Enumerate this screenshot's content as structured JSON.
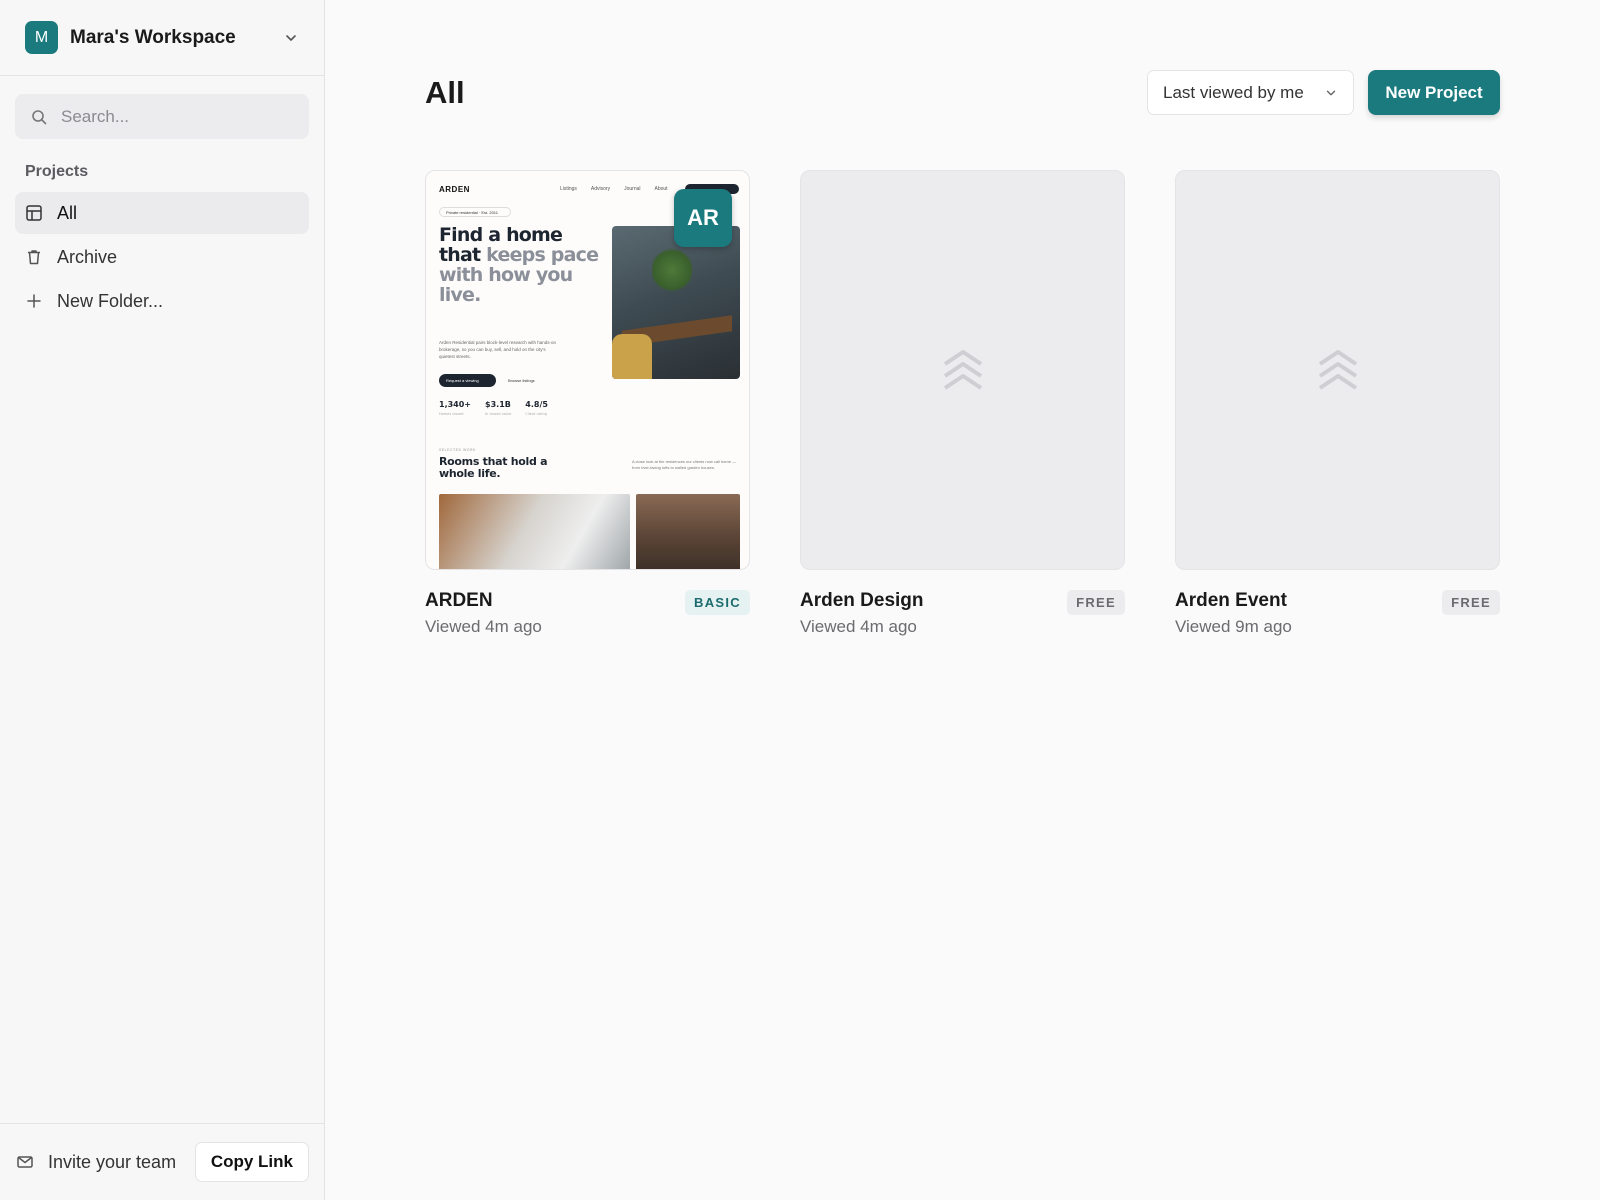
{
  "workspace": {
    "avatar": "M",
    "name": "Mara's Workspace"
  },
  "search": {
    "placeholder": "Search..."
  },
  "sidebar": {
    "section_label": "Projects",
    "items": [
      {
        "label": "All",
        "icon": "grid-icon",
        "active": true
      },
      {
        "label": "Archive",
        "icon": "trash-icon",
        "active": false
      },
      {
        "label": "New Folder...",
        "icon": "plus-icon",
        "active": false
      }
    ]
  },
  "footer": {
    "invite_label": "Invite your team",
    "copy_link_label": "Copy Link"
  },
  "header": {
    "title": "All",
    "sort_label": "Last viewed by me",
    "new_project_label": "New Project"
  },
  "colors": {
    "accent": "#1b7a7e"
  },
  "projects": [
    {
      "name": "ARDEN",
      "viewed": "Viewed 4m ago",
      "badge": "BASIC",
      "preview": {
        "logo": "ARDEN",
        "nav_links": [
          "Listings",
          "Advisory",
          "Journal",
          "About"
        ],
        "pill": "Private residential · Est. 2011",
        "headline_dark": "Find a home that",
        "headline_muted": "keeps pace with how you live.",
        "body": "Arden Residential pairs block-level research with hands-on brokerage, so you can buy, sell, and hold on the city's quietest streets.",
        "btn_primary": "Request a viewing",
        "btn_secondary": "Browse listings",
        "stats": [
          {
            "value": "1,340+",
            "label": "Homes closed"
          },
          {
            "value": "$3.1B",
            "label": "In closed value"
          },
          {
            "value": "4.8/5",
            "label": "Client rating"
          }
        ],
        "avatar": "AR",
        "eyebrow": "SELECTED WORK",
        "section_title": "Rooms that hold a whole life.",
        "section_side": "A close look at the residences our clients now call home — from river-facing lofts to walled garden houses."
      }
    },
    {
      "name": "Arden Design",
      "viewed": "Viewed 4m ago",
      "badge": "FREE"
    },
    {
      "name": "Arden Event",
      "viewed": "Viewed 9m ago",
      "badge": "FREE"
    }
  ]
}
